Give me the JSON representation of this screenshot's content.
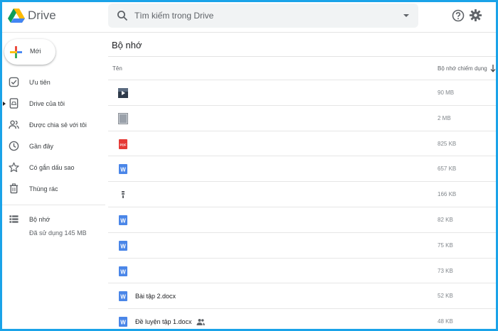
{
  "app": {
    "name": "Drive"
  },
  "search": {
    "placeholder": "Tìm kiếm trong Drive"
  },
  "sidebar": {
    "new_label": "Mới",
    "items": [
      {
        "label": "Ưu tiên",
        "icon": "check-square-icon"
      },
      {
        "label": "Drive của tôi",
        "icon": "my-drive-icon"
      },
      {
        "label": "Được chia sẻ với tôi",
        "icon": "people-icon"
      },
      {
        "label": "Gần đây",
        "icon": "clock-icon"
      },
      {
        "label": "Có gắn dấu sao",
        "icon": "star-icon"
      },
      {
        "label": "Thùng rác",
        "icon": "trash-icon"
      }
    ],
    "storage": {
      "label": "Bộ nhớ",
      "usage": "Đã sử dụng 145 MB",
      "icon": "storage-list-icon"
    }
  },
  "main": {
    "title": "Bộ nhớ",
    "columns": {
      "name": "Tên",
      "size": "Bộ nhớ chiếm dụng"
    },
    "files": [
      {
        "name": "",
        "size": "90 MB",
        "type": "video"
      },
      {
        "name": "",
        "size": "2 MB",
        "type": "image"
      },
      {
        "name": "",
        "size": "825 KB",
        "type": "pdf"
      },
      {
        "name": "",
        "size": "657 KB",
        "type": "word"
      },
      {
        "name": "",
        "size": "166 KB",
        "type": "archive"
      },
      {
        "name": "",
        "size": "82 KB",
        "type": "word"
      },
      {
        "name": "",
        "size": "75 KB",
        "type": "word"
      },
      {
        "name": "",
        "size": "73 KB",
        "type": "word"
      },
      {
        "name": "Bài tập 2.docx",
        "size": "52 KB",
        "type": "word"
      },
      {
        "name": "Đề luyện tập 1.docx",
        "size": "48 KB",
        "type": "word",
        "shared": true
      }
    ]
  },
  "colors": {
    "frame": "#1aa3e8",
    "word": "#4a86e8",
    "pdf": "#e53935"
  }
}
